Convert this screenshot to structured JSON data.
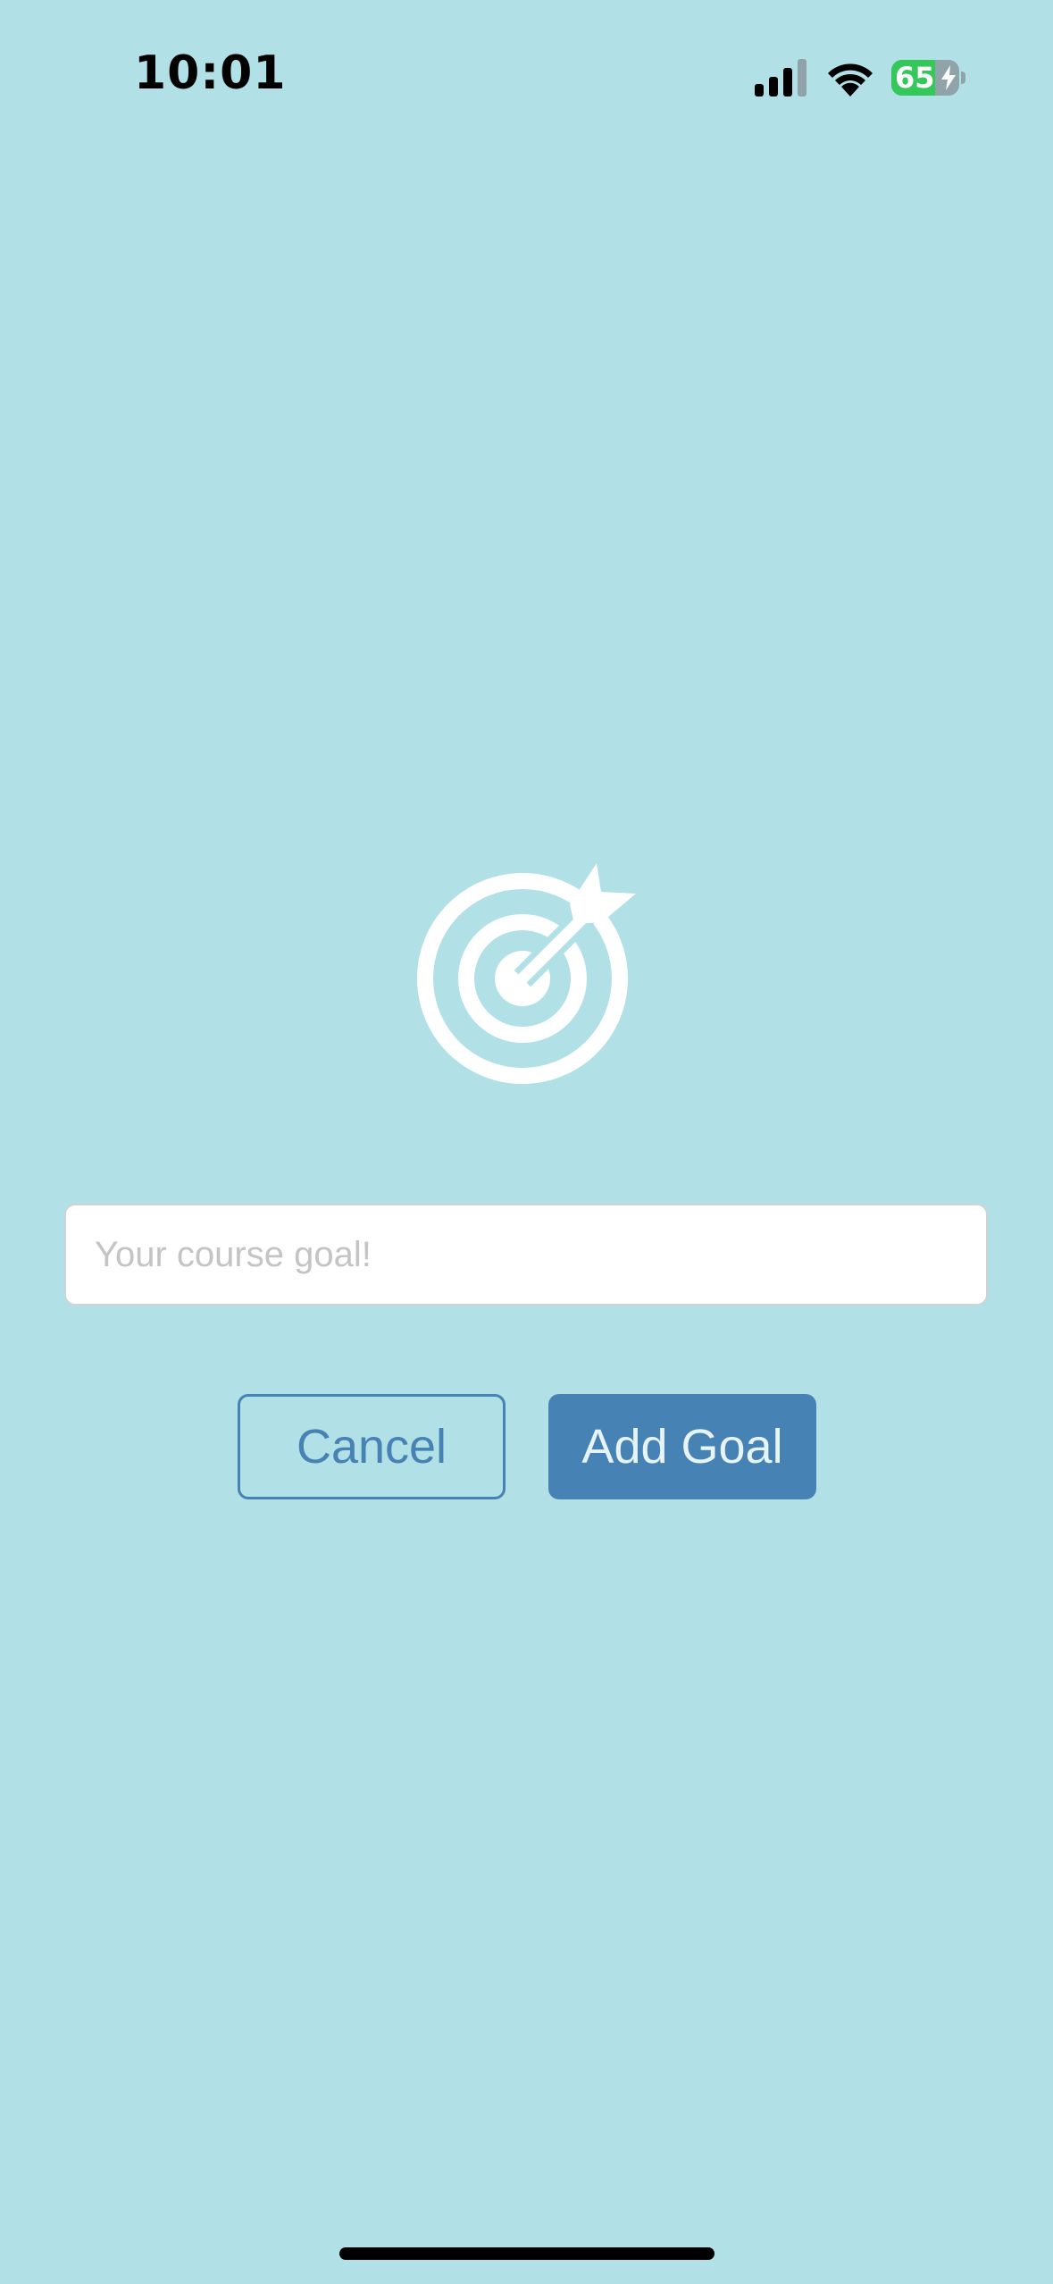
{
  "status_bar": {
    "time": "10:01",
    "battery_level": "65",
    "battery_fraction": 0.65,
    "signal_icon": "cellular-signal-icon",
    "wifi_icon": "wifi-icon",
    "charging_icon": "bolt-icon"
  },
  "main": {
    "icon": "target-with-arrow-icon",
    "input": {
      "value": "",
      "placeholder": "Your course goal!"
    },
    "buttons": {
      "cancel_label": "Cancel",
      "add_label": "Add Goal"
    }
  },
  "colors": {
    "background": "#b1e0e6",
    "accent": "#4682b4",
    "battery_green": "#34c759"
  }
}
